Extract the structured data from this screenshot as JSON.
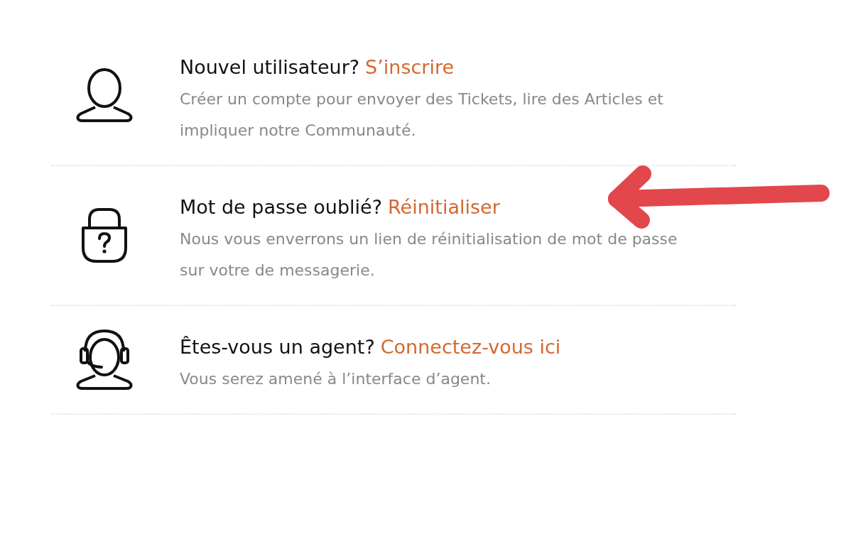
{
  "items": [
    {
      "kind": "user",
      "question": "Nouvel utilisateur?",
      "link": "S’inscrire",
      "description": "Créer un compte pour envoyer des Tickets, lire des Articles et impliquer notre Communauté."
    },
    {
      "kind": "lock",
      "question": "Mot de passe oublié?",
      "link": "Réinitialiser",
      "description": "Nous vous enverrons un lien de réinitialisation de mot de passe sur votre de messagerie."
    },
    {
      "kind": "agent",
      "question": "Êtes-vous un agent?",
      "link": "Connectez-vous ici",
      "description": "Vous serez amené à l’interface d’agent."
    }
  ]
}
